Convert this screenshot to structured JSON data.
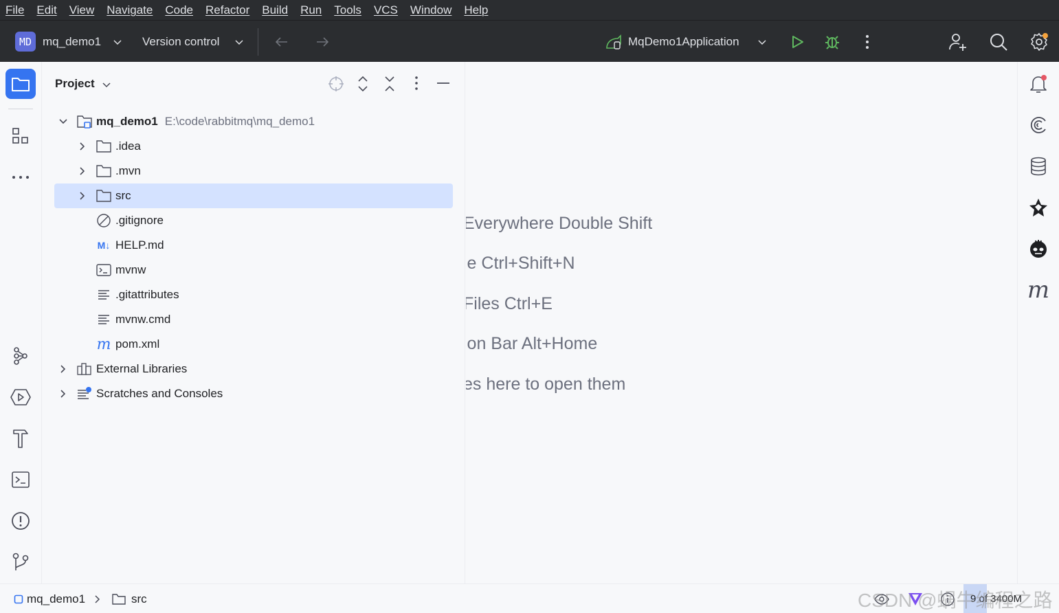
{
  "menu": [
    "File",
    "Edit",
    "View",
    "Navigate",
    "Code",
    "Refactor",
    "Build",
    "Run",
    "Tools",
    "VCS",
    "Window",
    "Help"
  ],
  "toolbar": {
    "project_badge": "MD",
    "project_name": "mq_demo1",
    "vcs_label": "Version control",
    "run_config": "MqDemo1Application"
  },
  "project_panel": {
    "title": "Project",
    "root": {
      "name": "mq_demo1",
      "path": "E:\\code\\rabbitmq\\mq_demo1"
    },
    "items": [
      {
        "name": ".idea",
        "icon": "folder-icon",
        "expandable": true
      },
      {
        "name": ".mvn",
        "icon": "folder-icon",
        "expandable": true
      },
      {
        "name": "src",
        "icon": "folder-icon",
        "expandable": true,
        "selected": true
      },
      {
        "name": ".gitignore",
        "icon": "ignore-file-icon",
        "expandable": false
      },
      {
        "name": "HELP.md",
        "icon": "markdown-icon",
        "expandable": false
      },
      {
        "name": "mvnw",
        "icon": "shell-script-icon",
        "expandable": false
      },
      {
        "name": ".gitattributes",
        "icon": "text-file-icon",
        "expandable": false
      },
      {
        "name": "mvnw.cmd",
        "icon": "text-file-icon",
        "expandable": false
      },
      {
        "name": "pom.xml",
        "icon": "maven-icon",
        "expandable": false
      }
    ],
    "external_libraries": "External Libraries",
    "scratches": "Scratches and Consoles"
  },
  "editor_hints": [
    "Everywhere Double Shift",
    "le Ctrl+Shift+N",
    "Files Ctrl+E",
    "ion Bar Alt+Home",
    "es here to open them"
  ],
  "statusbar": {
    "crumb_project": "mq_demo1",
    "crumb_folder": "src",
    "memory": "9 of 3400M",
    "memory_used_fraction": 0.0026,
    "watermark": "CSDN @蜗牛编程之路"
  },
  "colors": {
    "menubar_bg": "#2b2d30",
    "accent": "#3574f0",
    "selection": "#d4e2ff",
    "project_badge": "#5f6cd8",
    "run_green": "#5fb85f"
  }
}
